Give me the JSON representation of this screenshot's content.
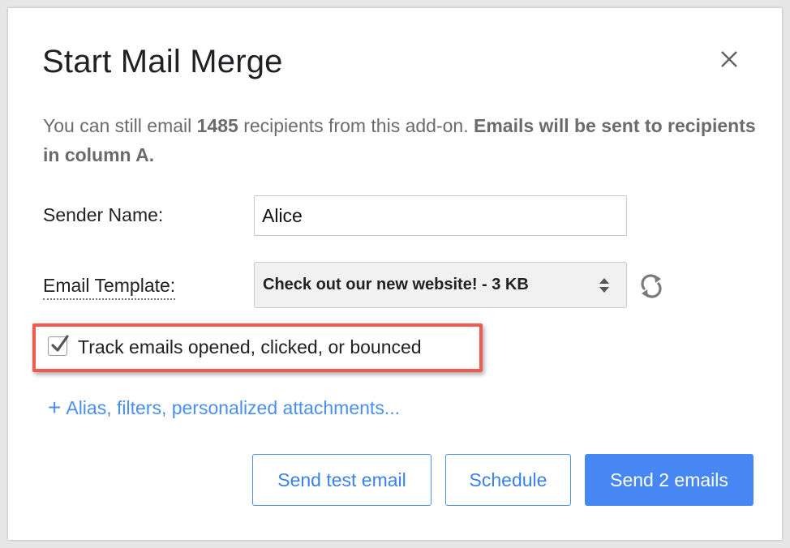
{
  "dialog": {
    "title": "Start Mail Merge"
  },
  "info": {
    "prefix": "You can still email ",
    "count": "1485",
    "middle": " recipients from this add-on. ",
    "bold_notice": "Emails will be sent to recipients in column A."
  },
  "form": {
    "sender_label": "Sender Name:",
    "sender_value": "Alice",
    "template_label": "Email Template:",
    "template_selected": "Check out our new website! - 3 KB"
  },
  "tracking": {
    "checked": true,
    "label": "Track emails opened, clicked, or bounced"
  },
  "more_options": {
    "icon": "plus-icon",
    "label": "Alias, filters, personalized attachments..."
  },
  "buttons": {
    "test": "Send test email",
    "schedule": "Schedule",
    "send": "Send 2 emails"
  },
  "colors": {
    "accent": "#4687f4",
    "link": "#4a8ff0",
    "highlight_border": "#ef5b4f"
  },
  "icons": {
    "close": "close-icon",
    "select_arrows": "up-down-arrows-icon",
    "refresh": "refresh-icon",
    "checkmark": "checkmark-icon"
  }
}
